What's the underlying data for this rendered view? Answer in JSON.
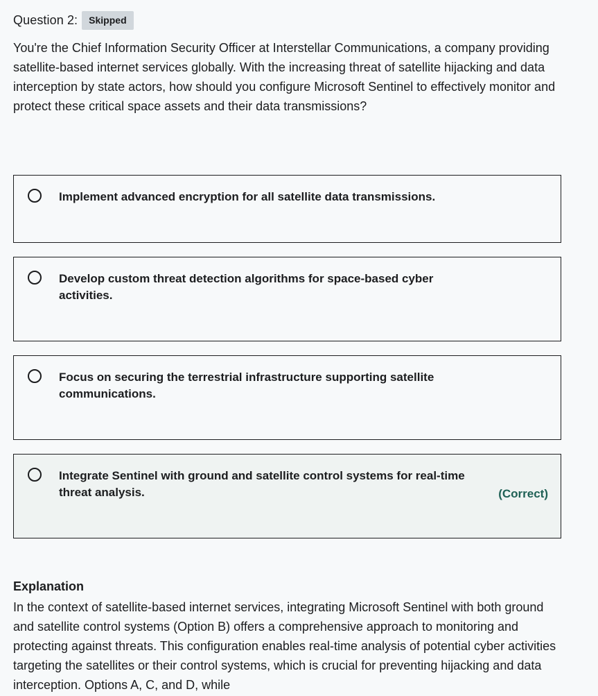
{
  "question": {
    "label": "Question 2:",
    "status": "Skipped",
    "prompt": "You're the Chief Information Security Officer at Interstellar Communications, a company providing satellite-based internet services globally. With the increasing threat of satellite hijacking and data interception by state actors, how should you configure Microsoft Sentinel to effectively monitor and protect these critical space assets and their data transmissions?"
  },
  "options": [
    {
      "text": "Implement advanced encryption for all satellite data transmissions."
    },
    {
      "text": "Develop custom threat detection algorithms for space-based cyber activities."
    },
    {
      "text": "Focus on securing the terrestrial infrastructure supporting satellite communications."
    },
    {
      "text": "Integrate Sentinel with ground and satellite control systems for real-time threat analysis.",
      "tag": "(Correct)"
    }
  ],
  "explanation": {
    "title": "Explanation",
    "body": "In the context of satellite-based internet services, integrating Microsoft Sentinel with both ground and satellite control systems (Option B) offers a comprehensive approach to monitoring and protecting against threats. This configuration enables real-time analysis of potential cyber activities targeting the satellites or their control systems, which is crucial for preventing hijacking and data interception. Options A, C, and D, while"
  }
}
